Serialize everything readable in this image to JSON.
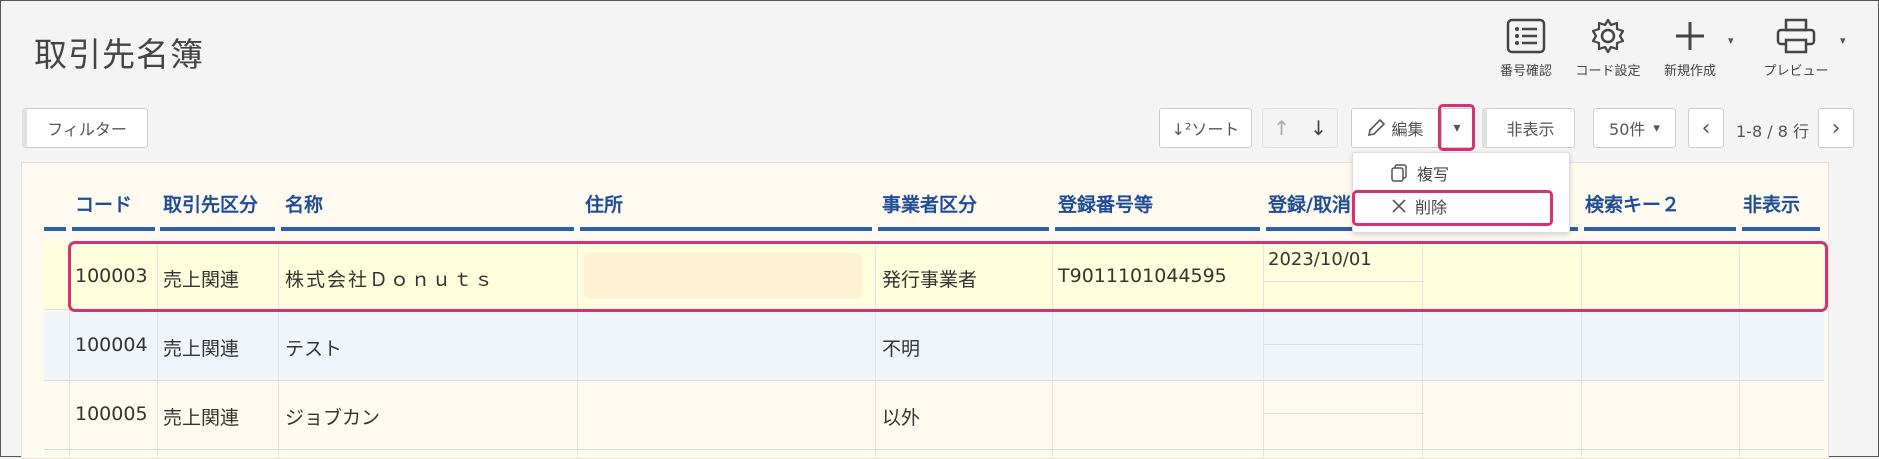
{
  "page": {
    "title": "取引先名簿"
  },
  "toolbar": {
    "number_check": "番号確認",
    "code_settings": "コード設定",
    "new_create": "新規作成",
    "preview": "プレビュー",
    "dropdown_caret": "▾"
  },
  "actions": {
    "filter": "フィルター",
    "sort": "↓²ソート",
    "up": "↑",
    "down": "↓",
    "edit": "編集",
    "edit_caret": "▾",
    "hide": "非表示",
    "per_page": "50件",
    "per_page_caret": "▾",
    "prev": "‹",
    "page_info": "1-8 / 8 行",
    "next": "›"
  },
  "menu": {
    "copy": "複写",
    "delete": "削除"
  },
  "table": {
    "columns": [
      "コード",
      "取引先区分",
      "名称",
      "住所",
      "事業者区分",
      "登録番号等",
      "登録/取消",
      "検索キー２",
      "非表示"
    ],
    "rows": [
      {
        "code": "100003",
        "category": "売上関連",
        "name": "株式会社Ｄｏｎｕｔｓ",
        "address": "",
        "business_type": "発行事業者",
        "reg_no": "T9011101044595",
        "reg_date": "2023/10/01"
      },
      {
        "code": "100004",
        "category": "売上関連",
        "name": "テスト",
        "address": "",
        "business_type": "不明",
        "reg_no": "",
        "reg_date": ""
      },
      {
        "code": "100005",
        "category": "売上関連",
        "name": "ジョブカン",
        "address": "",
        "business_type": "以外",
        "reg_no": "",
        "reg_date": ""
      }
    ]
  },
  "colors": {
    "accent": "#d43277",
    "header_text": "#1f4e96",
    "header_rule": "#2a5fab",
    "selected_row": "#ffffdd"
  }
}
